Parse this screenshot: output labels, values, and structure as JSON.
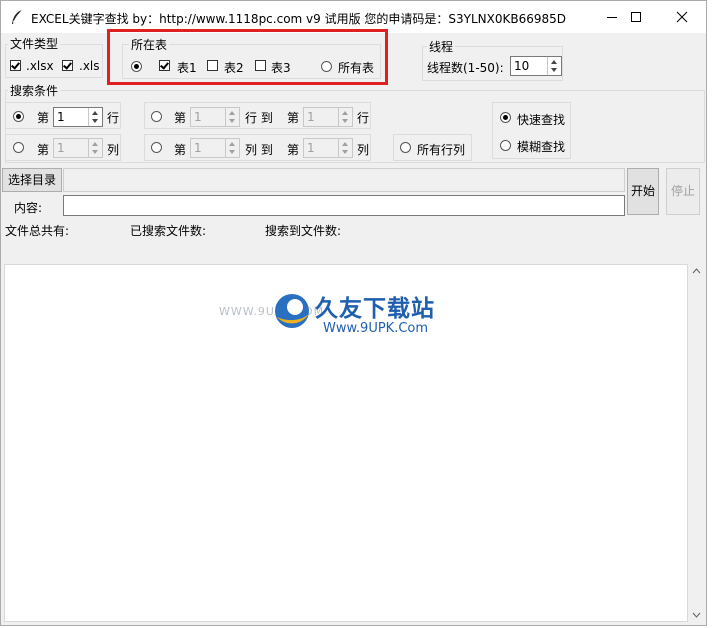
{
  "window": {
    "title": "EXCEL关键字查找  by：http://www.1118pc.com v9 试用版 您的申请码是：S3YLNX0KB66985D",
    "minimize_icon": "minimize-icon",
    "maximize_icon": "maximize-icon",
    "close_icon": "close-icon"
  },
  "file_type": {
    "legend": "文件类型",
    "xlsx": {
      "label": ".xlsx",
      "checked": true
    },
    "xls": {
      "label": ".xls",
      "checked": true
    }
  },
  "sheets": {
    "legend": "所在表",
    "radio_selected": true,
    "sheet1": {
      "label": "表1",
      "checked": true
    },
    "sheet2": {
      "label": "表2",
      "checked": false
    },
    "sheet3": {
      "label": "表3",
      "checked": false
    },
    "all_sheets": {
      "label": "所有表",
      "selected": false
    }
  },
  "threads": {
    "legend": "线程",
    "label": "线程数(1-50):",
    "value": "10"
  },
  "search_conditions": {
    "legend": "搜索条件",
    "row_mode": {
      "prefix": "第",
      "value": "1",
      "suffix": "行",
      "selected": true
    },
    "col_mode": {
      "prefix": "第",
      "value": "1",
      "suffix": "列",
      "selected": false
    },
    "row_range": {
      "prefix": "第",
      "from": "1",
      "mid": "行 到",
      "prefix2": "第",
      "to": "1",
      "suffix": "行",
      "selected": false
    },
    "col_range": {
      "prefix": "第",
      "from": "1",
      "mid": "列 到",
      "prefix2": "第",
      "to": "1",
      "suffix": "列",
      "selected": false
    },
    "all_rows_cols": {
      "label": "所有行列",
      "selected": false
    },
    "fast_search": {
      "label": "快速查找",
      "selected": true
    },
    "fuzzy_search": {
      "label": "模糊查找",
      "selected": false
    }
  },
  "toolbar": {
    "select_dir_label": "选择目录",
    "directory_value": "",
    "content_label": "内容:",
    "content_value": "",
    "start_label": "开始",
    "stop_label": "停止"
  },
  "status": {
    "total_files": "文件总共有:",
    "searched_files": "已搜索文件数:",
    "found_files": "搜索到文件数:"
  },
  "watermark": {
    "url_left": "WWW.9UPK.COM",
    "brand": "久友下载站",
    "url": "Www.9UPK.Com"
  }
}
